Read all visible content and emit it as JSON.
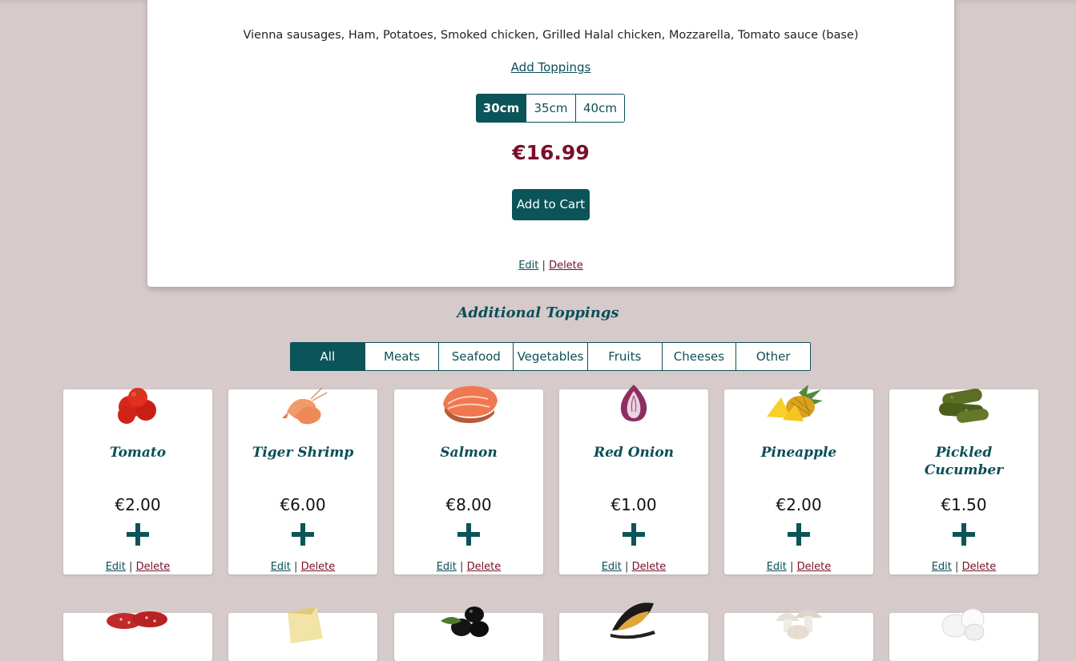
{
  "product": {
    "ingredients": "Vienna sausages, Ham, Potatoes, Smoked chicken, Grilled Halal chicken, Mozzarella, Tomato sauce (base)",
    "add_toppings_label": "Add Toppings",
    "sizes": [
      "30cm",
      "35cm",
      "40cm"
    ],
    "selected_size": "30cm",
    "price": "€16.99",
    "add_to_cart_label": "Add to Cart",
    "edit_label": "Edit",
    "delete_label": "Delete",
    "separator": "|"
  },
  "toppings_section": {
    "title": "Additional Toppings",
    "filters": [
      "All",
      "Meats",
      "Seafood",
      "Vegetables",
      "Fruits",
      "Cheeses",
      "Other"
    ],
    "active_filter": "All",
    "items": [
      {
        "name": "Tomato",
        "price": "€2.00",
        "icon": "tomato-icon",
        "edit": "Edit",
        "delete": "Delete"
      },
      {
        "name": "Tiger Shrimp",
        "price": "€6.00",
        "icon": "shrimp-icon",
        "edit": "Edit",
        "delete": "Delete"
      },
      {
        "name": "Salmon",
        "price": "€8.00",
        "icon": "salmon-icon",
        "edit": "Edit",
        "delete": "Delete"
      },
      {
        "name": "Red Onion",
        "price": "€1.00",
        "icon": "red-onion-icon",
        "edit": "Edit",
        "delete": "Delete"
      },
      {
        "name": "Pineapple",
        "price": "€2.00",
        "icon": "pineapple-icon",
        "edit": "Edit",
        "delete": "Delete"
      },
      {
        "name": "Pickled Cucumber",
        "price": "€1.50",
        "icon": "pickled-cucumber-icon",
        "edit": "Edit",
        "delete": "Delete"
      }
    ],
    "next_row_icons": [
      "salami-icon",
      "cheese-icon",
      "olives-icon",
      "mussel-icon",
      "mushroom-icon",
      "mozzarella-icon"
    ]
  },
  "colors": {
    "background": "#d6cbca",
    "accent": "#0b5459",
    "price": "#7a0f2a"
  }
}
